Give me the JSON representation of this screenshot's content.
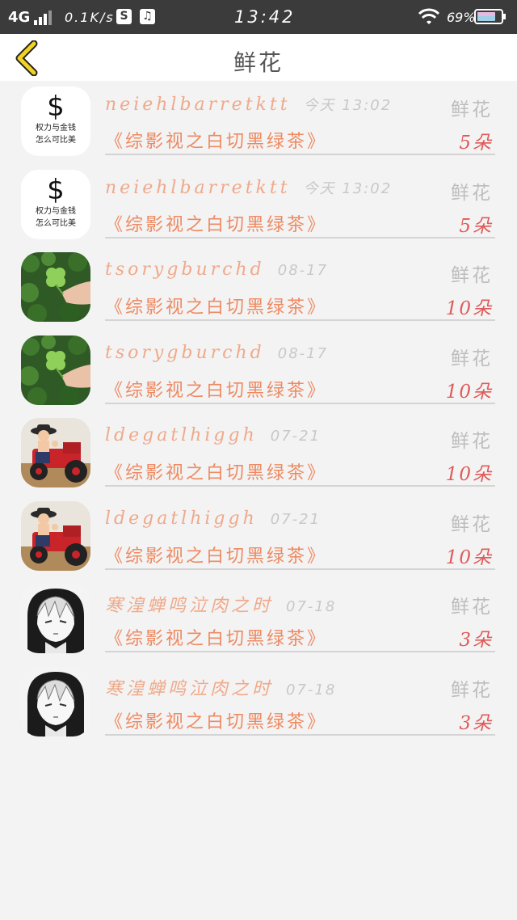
{
  "status_bar": {
    "network": "4G",
    "speed": "0.1K/s",
    "time": "13:42",
    "battery": "69%",
    "s_icon_label": "S",
    "music_icon_label": "♫"
  },
  "header": {
    "title": "鲜花",
    "back_icon": "chevron-left-icon",
    "accent_color": "#f2d31f"
  },
  "colors": {
    "username": "#f0a98a",
    "book_title": "#ee8a62",
    "count": "#e05a5a",
    "muted": "#c8c8c8"
  },
  "records": [
    {
      "avatar": "money-avatar",
      "avatar_text": {
        "sign": "$",
        "line1": "权力与金钱",
        "line2": "怎么可比美"
      },
      "username": "neiehlbarretktt",
      "time": "今天 13:02",
      "gift": "鲜花",
      "book": "《综影视之白切黑绿茶》",
      "count": "5朵"
    },
    {
      "avatar": "money-avatar",
      "avatar_text": {
        "sign": "$",
        "line1": "权力与金钱",
        "line2": "怎么可比美"
      },
      "username": "neiehlbarretktt",
      "time": "今天 13:02",
      "gift": "鲜花",
      "book": "《综影视之白切黑绿茶》",
      "count": "5朵"
    },
    {
      "avatar": "clover-avatar",
      "username": "tsorygburchd",
      "time": "08-17",
      "gift": "鲜花",
      "book": "《综影视之白切黑绿茶》",
      "count": "10朵"
    },
    {
      "avatar": "clover-avatar",
      "username": "tsorygburchd",
      "time": "08-17",
      "gift": "鲜花",
      "book": "《综影视之白切黑绿茶》",
      "count": "10朵"
    },
    {
      "avatar": "tractor-avatar",
      "username": "ldegatlhiggh",
      "time": "07-21",
      "gift": "鲜花",
      "book": "《综影视之白切黑绿茶》",
      "count": "10朵"
    },
    {
      "avatar": "tractor-avatar",
      "username": "ldegatlhiggh",
      "time": "07-21",
      "gift": "鲜花",
      "book": "《综影视之白切黑绿茶》",
      "count": "10朵"
    },
    {
      "avatar": "anime-avatar",
      "username": "寒湟蝉鸣泣肉之时",
      "time": "07-18",
      "gift": "鲜花",
      "book": "《综影视之白切黑绿茶》",
      "count": "3朵"
    },
    {
      "avatar": "anime-avatar",
      "username": "寒湟蝉鸣泣肉之时",
      "time": "07-18",
      "gift": "鲜花",
      "book": "《综影视之白切黑绿茶》",
      "count": "3朵"
    }
  ]
}
